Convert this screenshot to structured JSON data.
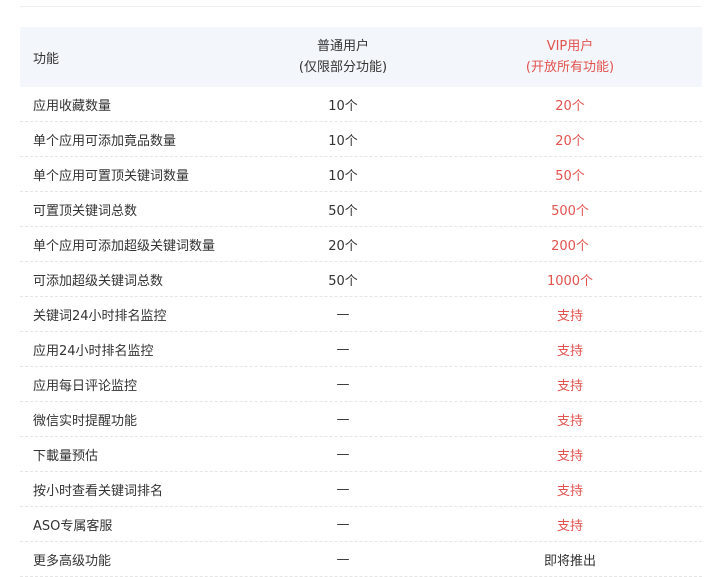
{
  "header": {
    "feature": "功能",
    "normal_title": "普通用户",
    "normal_sub": "(仅限部分功能)",
    "vip_title": "VIP用户",
    "vip_sub": "(开放所有功能)"
  },
  "rows": [
    {
      "feature": "应用收藏数量",
      "normal": "10个",
      "vip": "20个"
    },
    {
      "feature": "单个应用可添加竟品数量",
      "normal": "10个",
      "vip": "20个"
    },
    {
      "feature": "单个应用可置顶关键词数量",
      "normal": "10个",
      "vip": "50个"
    },
    {
      "feature": "可置顶关键词总数",
      "normal": "50个",
      "vip": "500个"
    },
    {
      "feature": "单个应用可添加超级关键词数量",
      "normal": "20个",
      "vip": "200个"
    },
    {
      "feature": "可添加超级关键词总数",
      "normal": "50个",
      "vip": "1000个"
    },
    {
      "feature": "关键词24小时排名监控",
      "normal": "—",
      "vip": "支持"
    },
    {
      "feature": "应用24小时排名监控",
      "normal": "—",
      "vip": "支持"
    },
    {
      "feature": "应用每日评论监控",
      "normal": "—",
      "vip": "支持"
    },
    {
      "feature": "微信实时提醒功能",
      "normal": "—",
      "vip": "支持"
    },
    {
      "feature": "下載量预估",
      "normal": "—",
      "vip": "支持"
    },
    {
      "feature": "按小时查看关键词排名",
      "normal": "—",
      "vip": "支持"
    },
    {
      "feature": "ASO专属客服",
      "normal": "—",
      "vip": "支持"
    },
    {
      "feature": "更多高级功能",
      "normal": "—",
      "vip": "即将推出"
    }
  ],
  "colors": {
    "vip_accent": "#e2534f",
    "header_bg": "#f3f6fa",
    "text": "#333333"
  }
}
